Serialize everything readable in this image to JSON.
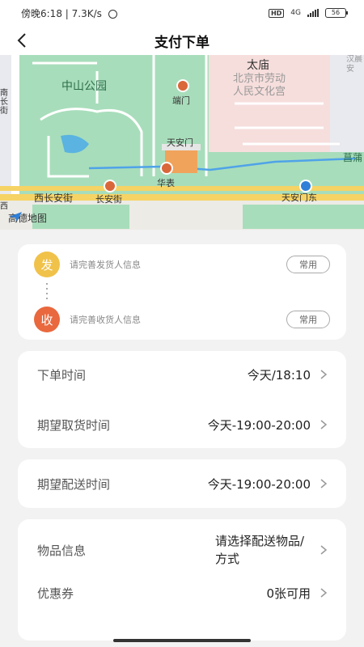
{
  "status_bar": {
    "time_network": "傍晚6:18 | 7.3K/s",
    "hd": "HD",
    "network_type": "4G",
    "battery": "56"
  },
  "nav": {
    "title": "支付下单",
    "back_icon": "back-arrow-icon"
  },
  "map": {
    "labels": {
      "zhongshan_park": "中山公园",
      "taimiao": "太庙",
      "workers_palace": "北京市劳动\n人民文化宫",
      "duanmen": "端门",
      "tiananmen": "天安门",
      "huabiao": "华表",
      "xichangan": "西长安街",
      "changan": "长安街",
      "tiananmen_east": "天安门东",
      "nanchangjie": "南长街",
      "xi": "西",
      "hanzhong": "汉晨安",
      "pucheng": "菖蒲"
    },
    "logo_text": "高德地图",
    "colors": {
      "green": "#a8ddbb",
      "road": "#f6d365",
      "route": "#4fa3e8"
    }
  },
  "addresses": {
    "sender": {
      "badge": "发",
      "hint": "请完善发货人信息",
      "button": "常用"
    },
    "receiver": {
      "badge": "收",
      "hint": "请完善收货人信息",
      "button": "常用"
    }
  },
  "order_time_card": {
    "rows": [
      {
        "label": "下单时间",
        "value": "今天/18:10"
      },
      {
        "label": "期望取货时间",
        "value": "今天-19:00-20:00"
      }
    ]
  },
  "delivery_card": {
    "label": "期望配送时间",
    "value": "今天-19:00-20:00"
  },
  "goods_card": {
    "rows": [
      {
        "label": "物品信息",
        "value": "请选择配送物品/方式"
      },
      {
        "label": "优惠券",
        "value": "0张可用"
      }
    ]
  }
}
